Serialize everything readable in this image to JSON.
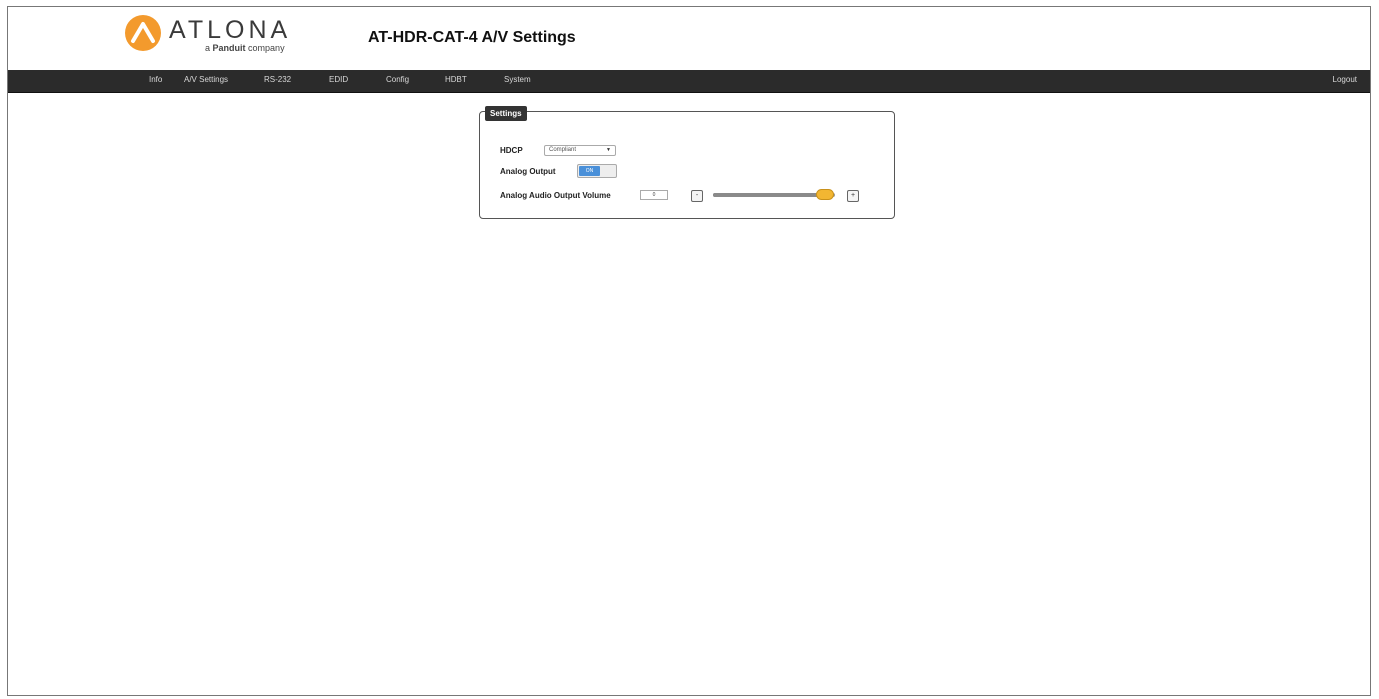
{
  "header": {
    "brand": "ATLONA",
    "brand_sub_prefix": "a",
    "brand_sub_strong": "Panduit",
    "brand_sub_suffix": "company",
    "title": "AT-HDR-CAT-4  A/V Settings"
  },
  "nav": {
    "items": [
      "Info",
      "A/V Settings",
      "RS-232",
      "EDID",
      "Config",
      "HDBT",
      "System"
    ],
    "logout": "Logout"
  },
  "panel": {
    "legend": "Settings",
    "hdcp_label": "HDCP",
    "hdcp_value": "Compliant",
    "analog_output_label": "Analog Output",
    "analog_output_state": "ON",
    "volume_label": "Analog Audio Output Volume",
    "volume_value": "0",
    "volume_minus": "-",
    "volume_plus": "+",
    "volume_level_fraction": 0.92
  },
  "colors": {
    "navbar": "#2b2b2b",
    "accent_toggle": "#4a90d9",
    "slider_thumb": "#f2b632",
    "logo_orange": "#f39a2d"
  },
  "icons": {
    "logo": "atlona-logo-icon",
    "dropdown": "chevron-down-icon"
  }
}
